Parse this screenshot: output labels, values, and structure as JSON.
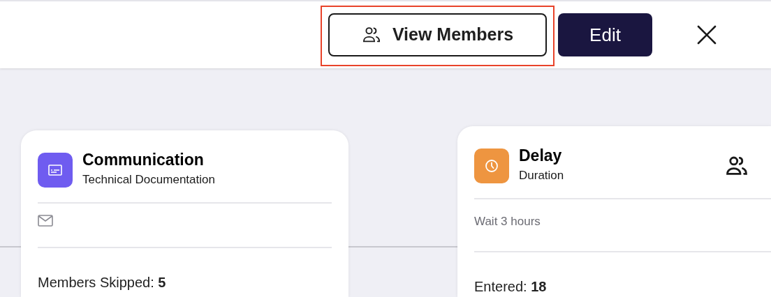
{
  "toolbar": {
    "buttons": [
      {
        "kind": "outline",
        "label": "View Members",
        "highlighted": true
      },
      {
        "kind": "primary",
        "label": "Edit",
        "highlighted": false
      }
    ]
  },
  "nodes": [
    {
      "kind": "communication",
      "color": "#6f5cf0",
      "title": "Communication",
      "subtitle": "Technical Documentation",
      "stat": "Members Skipped: **5**",
      "members_icon": false
    },
    {
      "kind": "delay",
      "color": "#ee9540",
      "title": "Delay",
      "subtitle": "Duration",
      "detail": "Wait 3 hours",
      "stat": "Entered: **18**",
      "members_icon": true
    }
  ]
}
